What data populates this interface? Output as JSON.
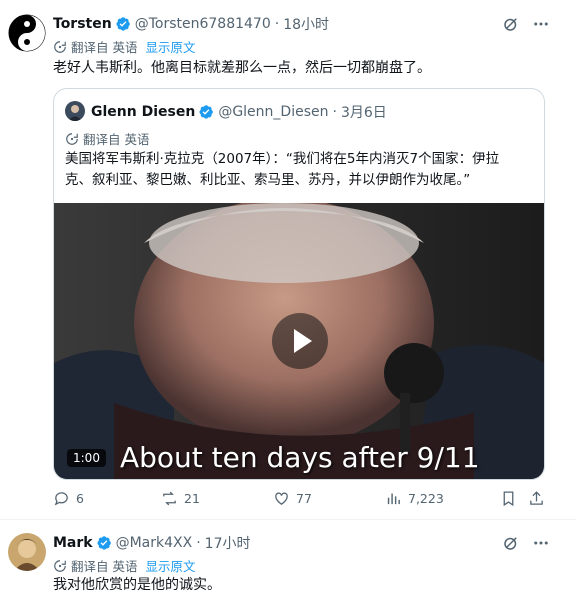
{
  "tweets": [
    {
      "author_name": "Torsten",
      "handle": "@Torsten67881470",
      "time": "18小时",
      "translate_label": "翻译自 英语",
      "show_original": "显示原文",
      "text": "老好人韦斯利。他离目标就差那么一点，然后一切都崩盘了。",
      "quote": {
        "author_name": "Glenn Diesen",
        "handle": "@Glenn_Diesen",
        "time": "3月6日",
        "translate_label": "翻译自 英语",
        "text_line1": "美国将军韦斯利·克拉克（2007年）：“我们将在5年内消灭7个国家：伊拉",
        "text_line2": "克、叙利亚、黎巴嫩、利比亚、索马里、苏丹，并以伊朗作为收尾。”",
        "video": {
          "caption": "About ten days after 9/11",
          "duration": "1:00"
        }
      },
      "actions": {
        "replies": "6",
        "reposts": "21",
        "likes": "77",
        "views": "7,223"
      }
    },
    {
      "author_name": "Mark",
      "handle": "@Mark4XX",
      "time": "17小时",
      "translate_label": "翻译自 英语",
      "show_original": "显示原文",
      "text": "我对他欣赏的是他的诚实。"
    }
  ],
  "icons": {
    "verified": "verified-badge-icon",
    "grok": "grok-icon",
    "more": "more-icon",
    "globe": "translate-icon",
    "reply": "reply-icon",
    "repost": "repost-icon",
    "like": "like-icon",
    "views": "views-icon",
    "bookmark": "bookmark-icon",
    "share": "share-icon",
    "play": "play-icon"
  },
  "colors": {
    "accent": "#1d9bf0",
    "secondary_text": "#536471",
    "border": "#cfd9de"
  }
}
